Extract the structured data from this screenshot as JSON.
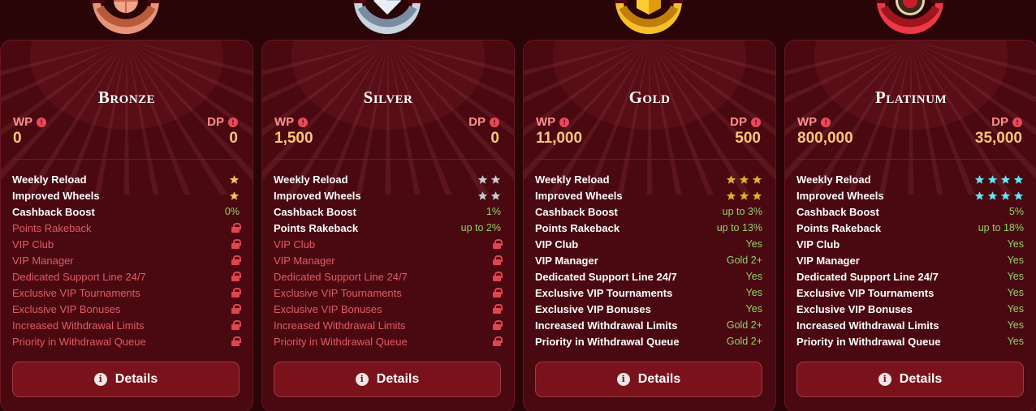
{
  "colors": {
    "background": "#2a0508",
    "card": "#4a0810",
    "label": "#ff8f8f",
    "points": "#f6c77a",
    "yes_value": "#8fd36a",
    "locked": "#e05c66",
    "bronze": "#e08a6c",
    "silver": "#b8c8d8",
    "gold": "#f4b21e",
    "platinum": "#e0303c",
    "platinum_star": "#5ee8f4"
  },
  "tiers": [
    {
      "name": "Bronze",
      "badge_icon": "bronze-badge-icon",
      "wp_label": "WP",
      "wp_value": "0",
      "dp_label": "DP",
      "dp_value": "0",
      "details_label": "Details",
      "perks": [
        {
          "label": "Weekly Reload",
          "stars": 1,
          "star_color": "#f0c060"
        },
        {
          "label": "Improved Wheels",
          "stars": 1,
          "star_color": "#f0c060"
        },
        {
          "label": "Cashback Boost",
          "value": "0%"
        },
        {
          "label": "Points Rakeback",
          "locked": true
        },
        {
          "label": "VIP Club",
          "locked": true
        },
        {
          "label": "VIP Manager",
          "locked": true
        },
        {
          "label": "Dedicated Support Line 24/7",
          "locked": true
        },
        {
          "label": "Exclusive VIP Tournaments",
          "locked": true
        },
        {
          "label": "Exclusive VIP Bonuses",
          "locked": true
        },
        {
          "label": "Increased Withdrawal Limits",
          "locked": true
        },
        {
          "label": "Priority in Withdrawal Queue",
          "locked": true
        }
      ]
    },
    {
      "name": "Silver",
      "badge_icon": "silver-badge-icon",
      "wp_label": "WP",
      "wp_value": "1,500",
      "dp_label": "DP",
      "dp_value": "0",
      "details_label": "Details",
      "perks": [
        {
          "label": "Weekly Reload",
          "stars": 2,
          "star_color": "#c4ccd8"
        },
        {
          "label": "Improved Wheels",
          "stars": 2,
          "star_color": "#c4ccd8"
        },
        {
          "label": "Cashback Boost",
          "value": "1%"
        },
        {
          "label": "Points Rakeback",
          "value": "up to 2%"
        },
        {
          "label": "VIP Club",
          "locked": true
        },
        {
          "label": "VIP Manager",
          "locked": true
        },
        {
          "label": "Dedicated Support Line 24/7",
          "locked": true
        },
        {
          "label": "Exclusive VIP Tournaments",
          "locked": true
        },
        {
          "label": "Exclusive VIP Bonuses",
          "locked": true
        },
        {
          "label": "Increased Withdrawal Limits",
          "locked": true
        },
        {
          "label": "Priority in Withdrawal Queue",
          "locked": true
        }
      ]
    },
    {
      "name": "Gold",
      "badge_icon": "gold-badge-icon",
      "wp_label": "WP",
      "wp_value": "11,000",
      "dp_label": "DP",
      "dp_value": "500",
      "details_label": "Details",
      "perks": [
        {
          "label": "Weekly Reload",
          "stars": 3,
          "star_color": "#e0b024"
        },
        {
          "label": "Improved Wheels",
          "stars": 3,
          "star_color": "#e0b024"
        },
        {
          "label": "Cashback Boost",
          "value": "up to 3%"
        },
        {
          "label": "Points Rakeback",
          "value": "up to 13%"
        },
        {
          "label": "VIP Club",
          "value": "Yes"
        },
        {
          "label": "VIP Manager",
          "value": "Gold 2+"
        },
        {
          "label": "Dedicated Support Line 24/7",
          "value": "Yes"
        },
        {
          "label": "Exclusive VIP Tournaments",
          "value": "Yes"
        },
        {
          "label": "Exclusive VIP Bonuses",
          "value": "Yes"
        },
        {
          "label": "Increased Withdrawal Limits",
          "value": "Gold 2+"
        },
        {
          "label": "Priority in Withdrawal Queue",
          "value": "Gold 2+"
        }
      ]
    },
    {
      "name": "Platinum",
      "badge_icon": "platinum-badge-icon",
      "wp_label": "WP",
      "wp_value": "800,000",
      "dp_label": "DP",
      "dp_value": "35,000",
      "details_label": "Details",
      "perks": [
        {
          "label": "Weekly Reload",
          "stars": 4,
          "star_color": "#5ee8f4"
        },
        {
          "label": "Improved Wheels",
          "stars": 4,
          "star_color": "#5ee8f4"
        },
        {
          "label": "Cashback Boost",
          "value": "5%"
        },
        {
          "label": "Points Rakeback",
          "value": "up to 18%"
        },
        {
          "label": "VIP Club",
          "value": "Yes"
        },
        {
          "label": "VIP Manager",
          "value": "Yes"
        },
        {
          "label": "Dedicated Support Line 24/7",
          "value": "Yes"
        },
        {
          "label": "Exclusive VIP Tournaments",
          "value": "Yes"
        },
        {
          "label": "Exclusive VIP Bonuses",
          "value": "Yes"
        },
        {
          "label": "Increased Withdrawal Limits",
          "value": "Yes"
        },
        {
          "label": "Priority in Withdrawal Queue",
          "value": "Yes"
        }
      ]
    }
  ]
}
